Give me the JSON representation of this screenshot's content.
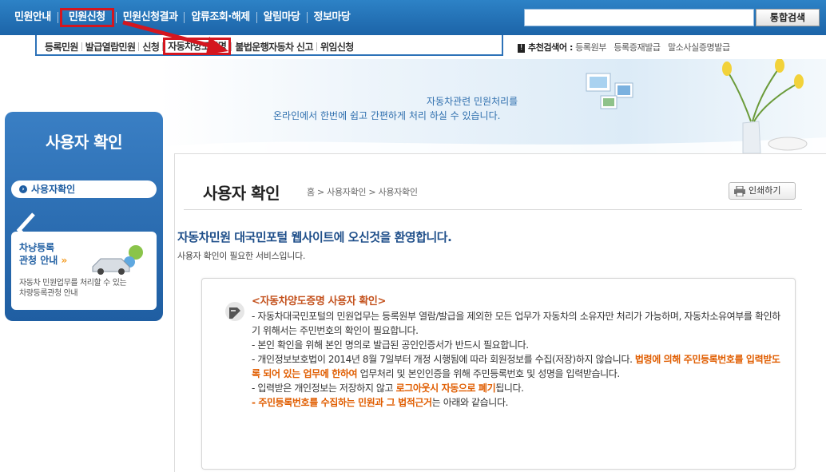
{
  "top_nav": {
    "items": [
      "민원안내",
      "민원신청",
      "민원신청결과",
      "압류조회·해제",
      "알림마당",
      "정보마당"
    ],
    "active_index": 1,
    "search_value": "",
    "search_button": "통합검색"
  },
  "sub_nav": {
    "items": [
      "등록민원",
      "발급열람민원",
      "신청",
      "자동차양도증명",
      "불법운행자동차 신고",
      "위임신청"
    ],
    "active_index": 3
  },
  "hot_keywords": {
    "label": "추천검색어 :",
    "items": [
      "등록원부",
      "등록증재발급",
      "말소사실증명발급"
    ]
  },
  "banner": {
    "line1": "자동차관련 민원처리를",
    "line2": "온라인에서 한번에 쉽고 간편하게 처리 하실 수 있습니다."
  },
  "sidebar": {
    "title": "사용자 확인",
    "menu_item": "사용자확인",
    "card_title_1": "차량등록",
    "card_title_2": "관청 안내",
    "card_chevron": "»",
    "card_desc_1": "자동차 민원업무를 처리할 수 있는",
    "card_desc_2": "차량등록관청 안내"
  },
  "page": {
    "title": "사용자 확인",
    "breadcrumb": "홈 > 사용자확인 > 사용자확인",
    "print_button": "인쇄하기",
    "welcome": "자동차민원 대국민포털 웹사이트에 오신것을 환영합니다.",
    "welcome_sub": "사용자 확인이 필요한 서비스입니다."
  },
  "notice": {
    "heading": "<자동차양도증명 사용자 확인>",
    "p1": "- 자동차대국민포털의 민원업무는 등록원부 열람/발급을 제외한 모든 업무가 자동차의 소유자만 처리가 가능하며, 자동차소유여부를 확인하기 위해서는 주민번호의 확인이 필요합니다.",
    "p2": "- 본인 확인을 위해 본인 명의로 발급된 공인인증서가 반드시 필요합니다.",
    "p3a": "- 개인정보보호법이 2014년 8월 7일부터 개정 시행됨에 따라 회원정보를 수집(저장)하지 않습니다. ",
    "p3b": "법령에 의해 주민등록번호를 입력받도록 되어 있는 업무에 한하여",
    "p3c": " 업무처리 및 본인인증을 위해 주민등록번호 및 성명을 입력받습니다.",
    "p4a": "- 입력받은 개인정보는 저장하지 않고 ",
    "p4b": "로그아웃시 자동으로 폐기",
    "p4c": "됩니다.",
    "p5a": "- ",
    "p5b": "주민등록번호를 수집하는 민원과 그 법적근거",
    "p5c": "는 아래와 같습니다."
  },
  "colors": {
    "nav_blue": "#1c64a8",
    "highlight_red": "#d4161f",
    "notice_orange": "#e05d00"
  }
}
